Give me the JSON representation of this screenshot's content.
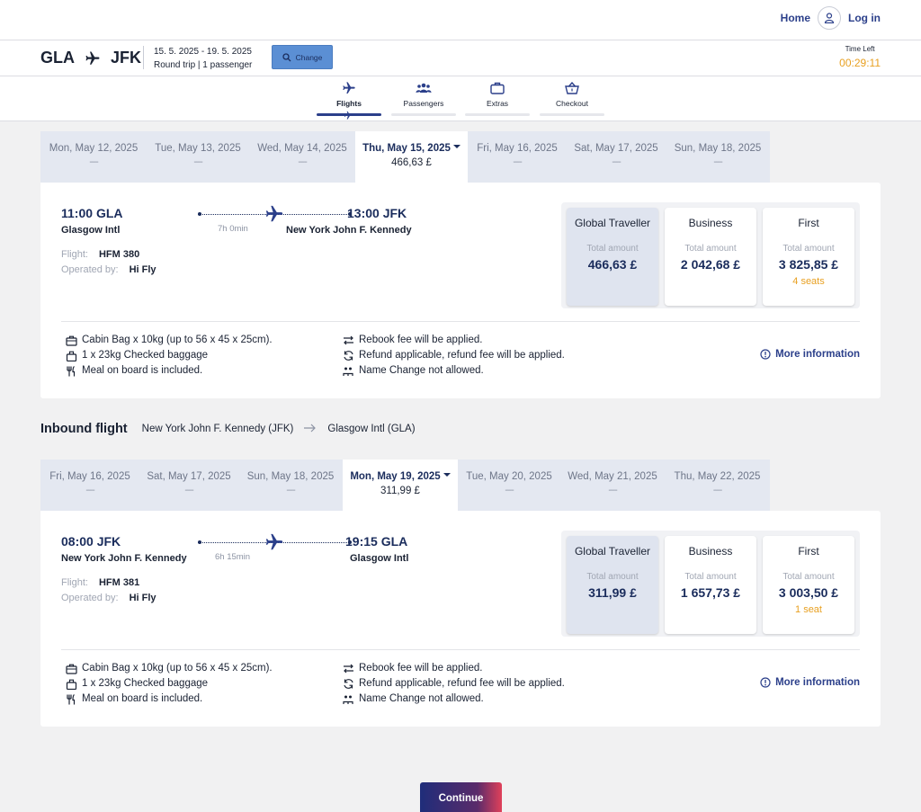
{
  "header": {
    "home": "Home",
    "login": "Log in"
  },
  "summary": {
    "origin": "GLA",
    "destination": "JFK",
    "dates": "15. 5. 2025 - 19. 5. 2025",
    "trip": "Round trip | 1 passenger",
    "change": "Change",
    "time_left_label": "Time Left",
    "time_left": "00:29:11"
  },
  "steps": [
    "Flights",
    "Passengers",
    "Extras",
    "Checkout"
  ],
  "outbound": {
    "dates": [
      {
        "label": "Mon, May 12, 2025",
        "price": "----"
      },
      {
        "label": "Tue, May 13, 2025",
        "price": "----"
      },
      {
        "label": "Wed, May 14, 2025",
        "price": "----"
      },
      {
        "label": "Thu, May 15, 2025",
        "price": "466,63 £"
      },
      {
        "label": "Fri, May 16, 2025",
        "price": "----"
      },
      {
        "label": "Sat, May 17, 2025",
        "price": "----"
      },
      {
        "label": "Sun, May 18, 2025",
        "price": "----"
      }
    ],
    "dep_time": "11:00",
    "dep_code": "GLA",
    "dep_city": "Glasgow Intl",
    "arr_time": "13:00",
    "arr_code": "JFK",
    "arr_city": "New York John F. Kennedy",
    "duration": "7h 0min",
    "flight_label": "Flight:",
    "flight": "HFM 380",
    "operated_label": "Operated by:",
    "operator": "Hi Fly",
    "fares": [
      {
        "name": "Global Traveller",
        "total_label": "Total amount",
        "price": "466,63 £",
        "seats": ""
      },
      {
        "name": "Business",
        "total_label": "Total amount",
        "price": "2 042,68 £",
        "seats": ""
      },
      {
        "name": "First",
        "total_label": "Total amount",
        "price": "3 825,85 £",
        "seats": "4 seats"
      }
    ]
  },
  "inbound": {
    "title": "Inbound flight",
    "from": "New York John F. Kennedy (JFK)",
    "to": "Glasgow Intl (GLA)",
    "dates": [
      {
        "label": "Fri, May 16, 2025",
        "price": "----"
      },
      {
        "label": "Sat, May 17, 2025",
        "price": "----"
      },
      {
        "label": "Sun, May 18, 2025",
        "price": "----"
      },
      {
        "label": "Mon, May 19, 2025",
        "price": "311,99 £"
      },
      {
        "label": "Tue, May 20, 2025",
        "price": "----"
      },
      {
        "label": "Wed, May 21, 2025",
        "price": "----"
      },
      {
        "label": "Thu, May 22, 2025",
        "price": "----"
      }
    ],
    "dep_time": "08:00",
    "dep_code": "JFK",
    "dep_city": "New York John F. Kennedy",
    "arr_time": "19:15",
    "arr_code": "GLA",
    "arr_city": "Glasgow Intl",
    "duration": "6h 15min",
    "flight_label": "Flight:",
    "flight": "HFM 381",
    "operated_label": "Operated by:",
    "operator": "Hi Fly",
    "fares": [
      {
        "name": "Global Traveller",
        "total_label": "Total amount",
        "price": "311,99 £",
        "seats": ""
      },
      {
        "name": "Business",
        "total_label": "Total amount",
        "price": "1 657,73 £",
        "seats": ""
      },
      {
        "name": "First",
        "total_label": "Total amount",
        "price": "3 003,50 £",
        "seats": "1 seat"
      }
    ]
  },
  "info": {
    "cabin": "Cabin Bag x 10kg (up to 56 x 45 x 25cm).",
    "checked": "1 x 23kg Checked baggage",
    "meal": "Meal on board is included.",
    "rebook": "Rebook fee will be applied.",
    "refund": "Refund applicable, refund fee will be applied.",
    "name_change": "Name Change not allowed.",
    "more": "More information"
  },
  "continue": "Continue"
}
